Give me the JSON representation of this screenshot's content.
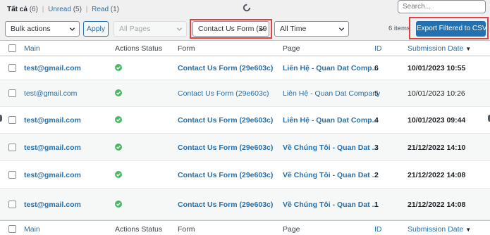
{
  "filters_views": [
    {
      "label": "Tất cả",
      "count": "(6)",
      "current": true
    },
    {
      "label": "Unread",
      "count": "(5)",
      "current": false
    },
    {
      "label": "Read",
      "count": "(1)",
      "current": false
    }
  ],
  "search": {
    "placeholder": "Search..."
  },
  "toolbar": {
    "bulk_actions": "Bulk actions",
    "apply_label": "Apply",
    "pages_filter": "All Pages",
    "form_filter": "Contact Us Form (29",
    "time_filter": "All Time",
    "items_count": "6 items",
    "export_label": "Export Filtered to CSV"
  },
  "table": {
    "columns": {
      "main": "Main",
      "status": "Actions Status",
      "form": "Form",
      "page": "Page",
      "id": "ID",
      "date": "Submission Date",
      "sort_indicator": "▼"
    },
    "rows": [
      {
        "main": "test@gmail.com",
        "form": "Contact Us Form (29e603c)",
        "page": "Liên Hệ - Quan Dat Comp...",
        "id": "6",
        "date": "10/01/2023 10:55",
        "unread": true
      },
      {
        "main": "test@gmail.com",
        "form": "Contact Us Form (29e603c)",
        "page": "Liên Hệ - Quan Dat Company",
        "id": "5",
        "date": "10/01/2023 10:26",
        "unread": false
      },
      {
        "main": "test@gmail.com",
        "form": "Contact Us Form (29e603c)",
        "page": "Liên Hệ - Quan Dat Comp...",
        "id": "4",
        "date": "10/01/2023 09:44",
        "unread": true
      },
      {
        "main": "test@gmail.com",
        "form": "Contact Us Form (29e603c)",
        "page": "Về Chúng Tôi - Quan Dat ...",
        "id": "3",
        "date": "21/12/2022 14:10",
        "unread": true
      },
      {
        "main": "test@gmail.com",
        "form": "Contact Us Form (29e603c)",
        "page": "Về Chúng Tôi - Quan Dat ...",
        "id": "2",
        "date": "21/12/2022 14:08",
        "unread": true
      },
      {
        "main": "test@gmail.com",
        "form": "Contact Us Form (29e603c)",
        "page": "Về Chúng Tôi - Quan Dat ...",
        "id": "1",
        "date": "21/12/2022 14:08",
        "unread": true
      }
    ]
  },
  "colors": {
    "accent": "#2271b1",
    "status_ok": "#4ab866",
    "highlight": "#e04242"
  },
  "icons": {
    "status": "check-circle-icon",
    "dropdown": "chevron-down-icon",
    "loading": "spinner-icon"
  }
}
